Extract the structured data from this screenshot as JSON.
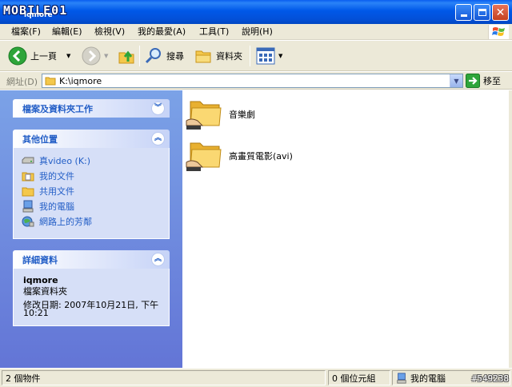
{
  "titlebar": {
    "logo": "MOBILE01",
    "title": "iqmore"
  },
  "menu": {
    "items": [
      "檔案(F)",
      "編輯(E)",
      "檢視(V)",
      "我的最愛(A)",
      "工具(T)",
      "說明(H)"
    ]
  },
  "toolbar": {
    "back_label": "上一頁",
    "search_label": "搜尋",
    "folders_label": "資料夾"
  },
  "address": {
    "label": "網址(D)",
    "value": "K:\\iqmore",
    "go_label": "移至"
  },
  "taskpane": {
    "file_tasks": {
      "title": "檔案及資料夾工作"
    },
    "other_places": {
      "title": "其他位置",
      "links": [
        {
          "label": "真video (K:)",
          "icon": "drive-icon"
        },
        {
          "label": "我的文件",
          "icon": "my-documents-icon"
        },
        {
          "label": "共用文件",
          "icon": "shared-folder-icon"
        },
        {
          "label": "我的電腦",
          "icon": "my-computer-icon"
        },
        {
          "label": "網路上的芳鄰",
          "icon": "network-icon"
        }
      ]
    },
    "details": {
      "title": "詳細資料",
      "name": "iqmore",
      "type": "檔案資料夾",
      "modified_line1": "修改日期: 2007年10月21日, 下午",
      "modified_line2": "10:21"
    }
  },
  "content": {
    "folders": [
      {
        "name": "音樂劇"
      },
      {
        "name": "高畫質電影(avi)"
      }
    ]
  },
  "statusbar": {
    "object_count": "2 個物件",
    "size": "0 個位元組",
    "location": "我的電腦",
    "watermark": "#549238"
  }
}
